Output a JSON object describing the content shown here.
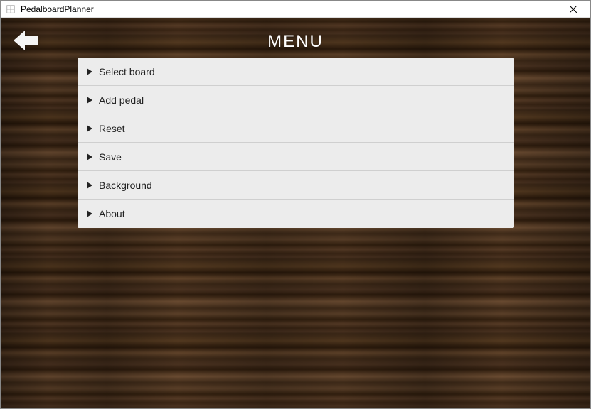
{
  "window": {
    "title": "PedalboardPlanner"
  },
  "menu": {
    "heading": "MENU",
    "items": [
      {
        "label": "Select board"
      },
      {
        "label": "Add pedal"
      },
      {
        "label": "Reset"
      },
      {
        "label": "Save"
      },
      {
        "label": "Background"
      },
      {
        "label": "About"
      }
    ]
  }
}
